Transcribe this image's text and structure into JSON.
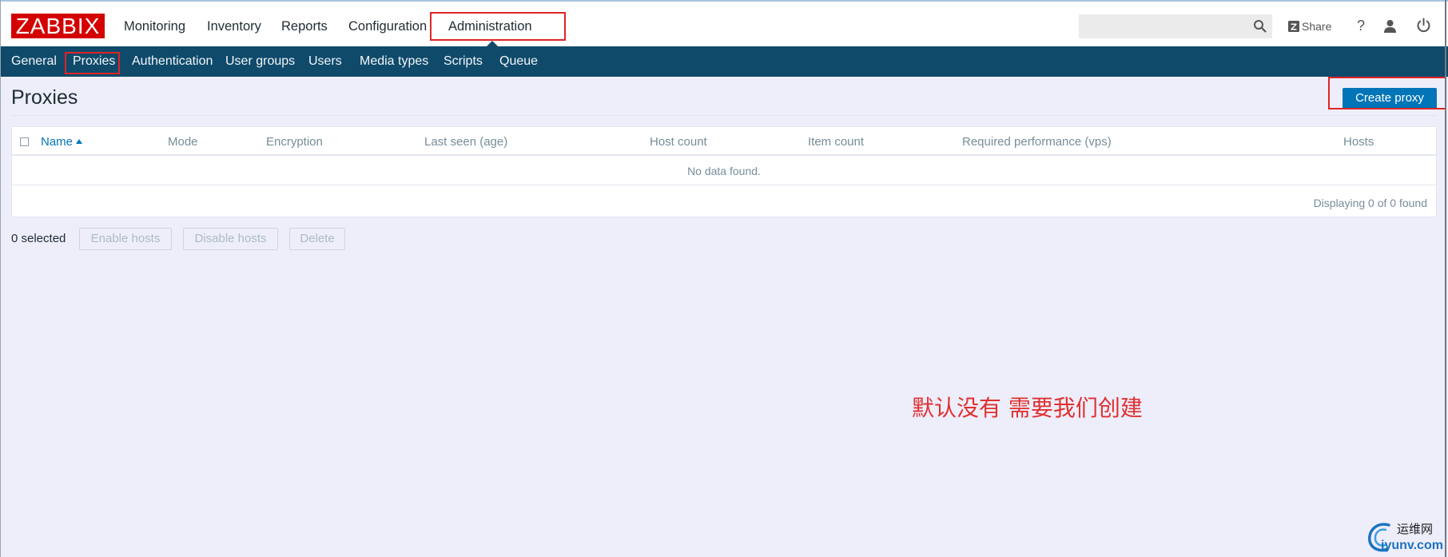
{
  "app": {
    "logo": "ZABBIX"
  },
  "top_nav": {
    "items": [
      "Monitoring",
      "Inventory",
      "Reports",
      "Configuration",
      "Administration"
    ],
    "selected": "Administration"
  },
  "search": {
    "value": "",
    "placeholder": ""
  },
  "header_actions": {
    "share_label": "Share",
    "help_label": "?"
  },
  "sub_nav": {
    "items": [
      "General",
      "Proxies",
      "Authentication",
      "User groups",
      "Users",
      "Media types",
      "Scripts",
      "Queue"
    ],
    "selected": "Proxies"
  },
  "page": {
    "title": "Proxies",
    "create_button": "Create proxy"
  },
  "table": {
    "columns": [
      "Name",
      "Mode",
      "Encryption",
      "Last seen (age)",
      "Host count",
      "Item count",
      "Required performance (vps)",
      "Hosts"
    ],
    "sort_column": "Name",
    "sort_direction": "asc",
    "empty_message": "No data found.",
    "footer": "Displaying 0 of 0 found"
  },
  "actions": {
    "selected_count": "0 selected",
    "buttons": [
      "Enable hosts",
      "Disable hosts",
      "Delete"
    ],
    "buttons_enabled": false
  },
  "annotation": {
    "text": "默认没有 需要我们创建"
  },
  "watermark": {
    "text_cn": "运维网",
    "text_en": "iyunv.com"
  },
  "icons": {
    "search": "search-icon",
    "share": "share-icon",
    "help": "help-icon",
    "profile": "user-icon",
    "logout": "power-icon",
    "sort": "sort-asc-icon",
    "select_all": "checkbox-icon"
  },
  "colors": {
    "brand_red": "#d40000",
    "nav_bg": "#0f4a6b",
    "primary": "#0275b8",
    "page_bg": "#eeeefb",
    "annotation_red": "#e03030"
  }
}
